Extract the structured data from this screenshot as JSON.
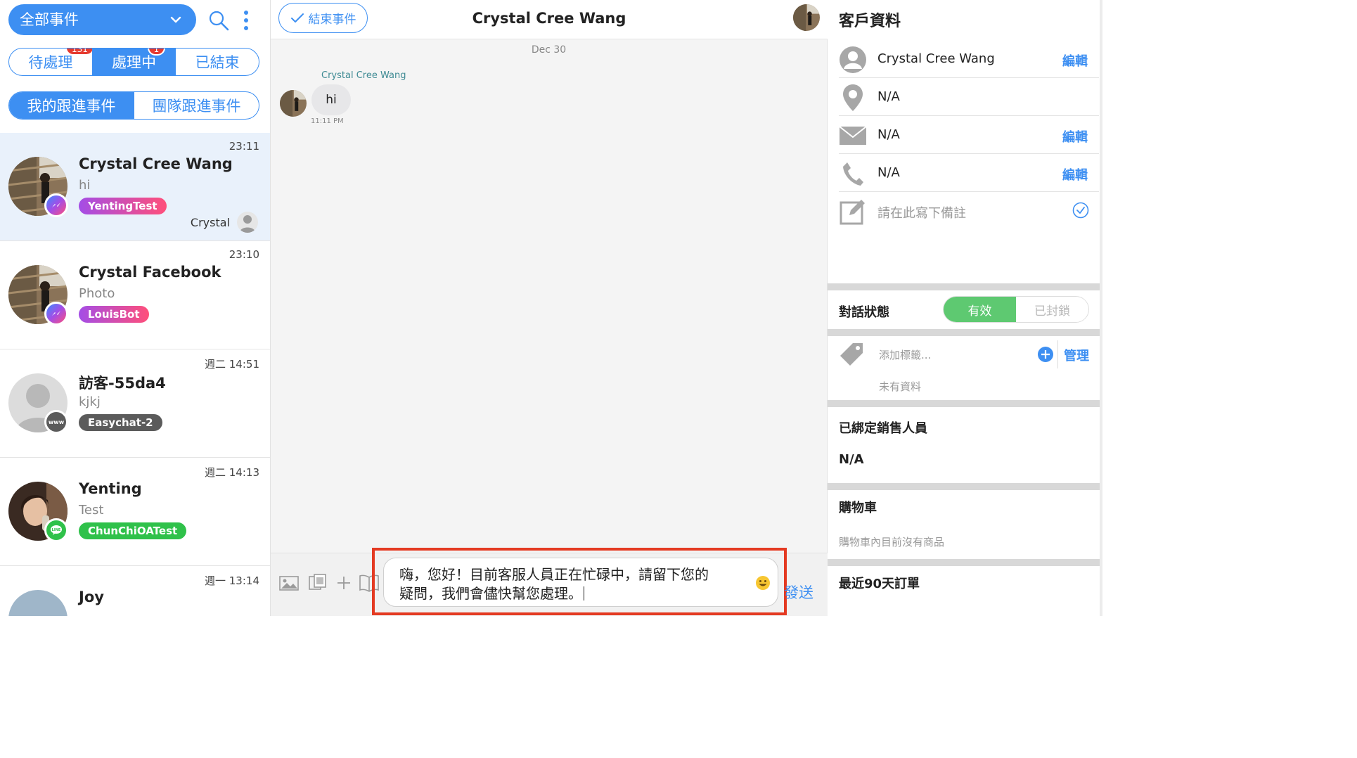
{
  "left": {
    "filter_label": "全部事件",
    "status_tabs": [
      {
        "label": "待處理",
        "badge": "131"
      },
      {
        "label": "處理中",
        "badge": "1"
      },
      {
        "label": "已結束",
        "badge": ""
      }
    ],
    "scope_tabs": [
      "我的跟進事件",
      "團隊跟進事件"
    ],
    "conversations": [
      {
        "time": "23:11",
        "name": "Crystal Cree Wang",
        "preview": "hi",
        "tag": "YentingTest",
        "channel": "messenger",
        "agent": "Crystal"
      },
      {
        "time": "23:10",
        "name": "Crystal Facebook",
        "preview": "Photo",
        "tag": "LouisBot",
        "channel": "messenger"
      },
      {
        "time": "週二 14:51",
        "name": "訪客-55da4",
        "preview": "kjkj",
        "tag": "Easychat-2",
        "channel": "www"
      },
      {
        "time": "週二 14:13",
        "name": "Yenting",
        "preview": "Test",
        "tag": "ChunChiOATest",
        "channel": "line"
      },
      {
        "time": "週一 13:14",
        "name": "Joy",
        "preview": "",
        "tag": "",
        "channel": ""
      }
    ]
  },
  "chat": {
    "end_button": "結束事件",
    "title": "Crystal Cree Wang",
    "date_divider": "Dec 30",
    "messages": [
      {
        "sender": "Crystal Cree Wang",
        "text": "hi",
        "time": "11:11 PM"
      }
    ],
    "composer": {
      "text_line1": "嗨，您好！目前客服人員正在忙碌中，請留下您的",
      "text_line2": "疑問，我們會儘快幫您處理。",
      "send": "發送"
    }
  },
  "customer": {
    "title": "客戶資料",
    "name": "Crystal Cree Wang",
    "location": "N/A",
    "email": "N/A",
    "phone": "N/A",
    "edit_label": "編輯",
    "note_placeholder": "請在此寫下備註",
    "conversation_status_label": "對話狀態",
    "status_active": "有效",
    "status_blocked": "已封鎖",
    "tag_placeholder": "添加標籤...",
    "manage_label": "管理",
    "tags_empty": "未有資料",
    "sales_label": "已綁定銷售人員",
    "sales_value": "N/A",
    "cart_label": "購物車",
    "cart_empty": "購物車內目前沒有商品",
    "orders_label": "最近90天訂單"
  },
  "colors": {
    "accent": "#3d8ff2",
    "badge": "#e53a2f",
    "active_green": "#5ec971",
    "tag_gradient_a": "#a44de6",
    "tag_gradient_b": "#ff4f7a",
    "line_green": "#2fc14a",
    "highlight_frame": "#e43a22"
  }
}
